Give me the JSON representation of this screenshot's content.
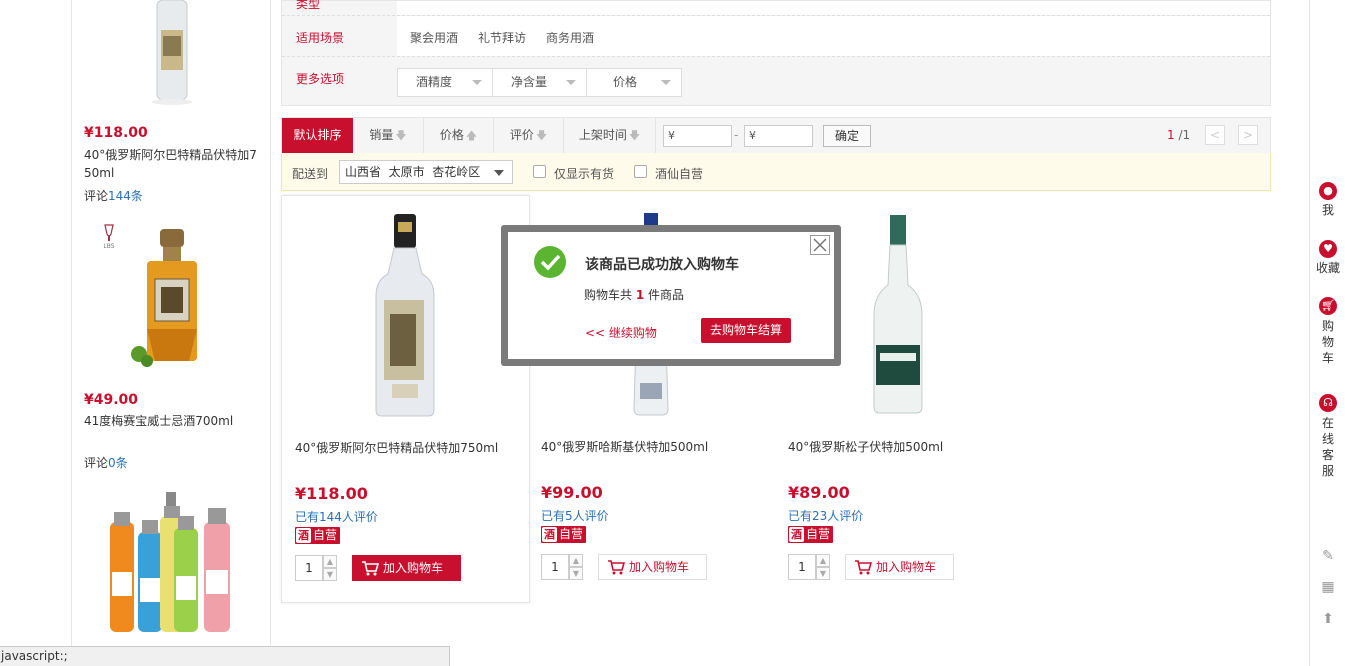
{
  "sidebar": {
    "items": [
      {
        "price": "¥118.00",
        "name": "40°俄罗斯阿尔巴特精品伏特加750ml",
        "review_prefix": "评论",
        "review_count": "144条"
      },
      {
        "price": "¥49.00",
        "name": "41度梅赛宝威士忌酒700ml",
        "review_prefix": "评论",
        "review_count": "0条"
      }
    ],
    "lbs_logo": "LBS"
  },
  "filters": {
    "top_row_key": "类型",
    "scene_key": "适用场景",
    "scene_values": [
      "聚会用酒",
      "礼节拜访",
      "商务用酒"
    ],
    "more_key": "更多选项",
    "more_dropdowns": [
      "酒精度",
      "净含量",
      "价格"
    ]
  },
  "sort": {
    "default": "默认排序",
    "sales": "销量",
    "price": "价格",
    "review": "评价",
    "time": "上架时间",
    "price_from": "¥",
    "dash": "-",
    "price_to": "¥",
    "confirm": "确定",
    "page_current": "1",
    "page_total": "/1",
    "prev": "<",
    "next": ">"
  },
  "delivery": {
    "label": "配送到",
    "location": "山西省  太原市  杏花岭区",
    "in_stock_only": "仅显示有货",
    "self_run": "酒仙自营"
  },
  "products": [
    {
      "name": "40°俄罗斯阿尔巴特精品伏特加750ml",
      "price": "¥118.00",
      "reviews": "已有144人评价",
      "badge": "自营",
      "qty": "1",
      "add_cart": "加入购物车"
    },
    {
      "name": "40°俄罗斯哈斯基伏特加500ml",
      "price": "¥99.00",
      "reviews": "已有5人评价",
      "badge": "自营",
      "qty": "1",
      "add_cart": "加入购物车"
    },
    {
      "name": "40°俄罗斯松子伏特加500ml",
      "price": "¥89.00",
      "reviews": "已有23人评价",
      "badge": "自营",
      "qty": "1",
      "add_cart": "加入购物车"
    }
  ],
  "modal": {
    "title": "该商品已成功放入购物车",
    "sub_prefix": "购物车共",
    "count": "1",
    "sub_suffix": "件商品",
    "continue": "<< 继续购物",
    "checkout": "去购物车结算"
  },
  "right_toolbar": {
    "me": "我",
    "favorites": "收藏",
    "cart": "购物车",
    "service": "在线客服"
  },
  "status_bar": "javascript:;",
  "colors": {
    "accent": "#c8102e",
    "link": "#2a6fb5",
    "success": "#5cb531"
  }
}
